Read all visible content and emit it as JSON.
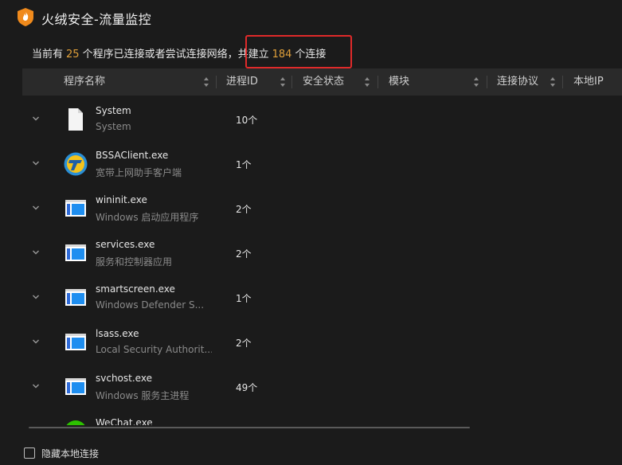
{
  "window": {
    "title": "火绒安全-流量监控"
  },
  "summary": {
    "prefix": "当前有",
    "program_count": "25",
    "middle": "个程序已连接或者尝试连接网络，",
    "boxed_prefix": "共建立",
    "connection_count": "184",
    "boxed_suffix": "个连接"
  },
  "table": {
    "columns": [
      {
        "label": "程序名称"
      },
      {
        "label": "进程ID"
      },
      {
        "label": "安全状态"
      },
      {
        "label": "模块"
      },
      {
        "label": "连接协议"
      },
      {
        "label": "本地IP"
      }
    ],
    "rows": [
      {
        "name": "System",
        "desc": "System",
        "pid": "10个",
        "icon": "document-icon"
      },
      {
        "name": "BSSAClient.exe",
        "desc": "宽带上网助手客户端",
        "pid": "1个",
        "icon": "bssa-logo-icon"
      },
      {
        "name": "wininit.exe",
        "desc": "Windows 启动应用程序",
        "pid": "2个",
        "icon": "window-app-icon"
      },
      {
        "name": "services.exe",
        "desc": "服务和控制器应用",
        "pid": "2个",
        "icon": "window-app-icon"
      },
      {
        "name": "smartscreen.exe",
        "desc": "Windows Defender S...",
        "pid": "1个",
        "icon": "window-app-icon"
      },
      {
        "name": "lsass.exe",
        "desc": "Local Security Authorit...",
        "pid": "2个",
        "icon": "window-app-icon"
      },
      {
        "name": "svchost.exe",
        "desc": "Windows 服务主进程",
        "pid": "49个",
        "icon": "window-app-icon"
      },
      {
        "name": "WeChat.exe",
        "desc": "",
        "pid": "",
        "icon": "wechat-icon"
      }
    ]
  },
  "footer": {
    "hide_local_label": "隐藏本地连接"
  },
  "colors": {
    "background": "#1b1b1b",
    "header_bg": "#2a2a2a",
    "accent_number": "#e0a03a",
    "highlight_box": "#e02a2a"
  }
}
